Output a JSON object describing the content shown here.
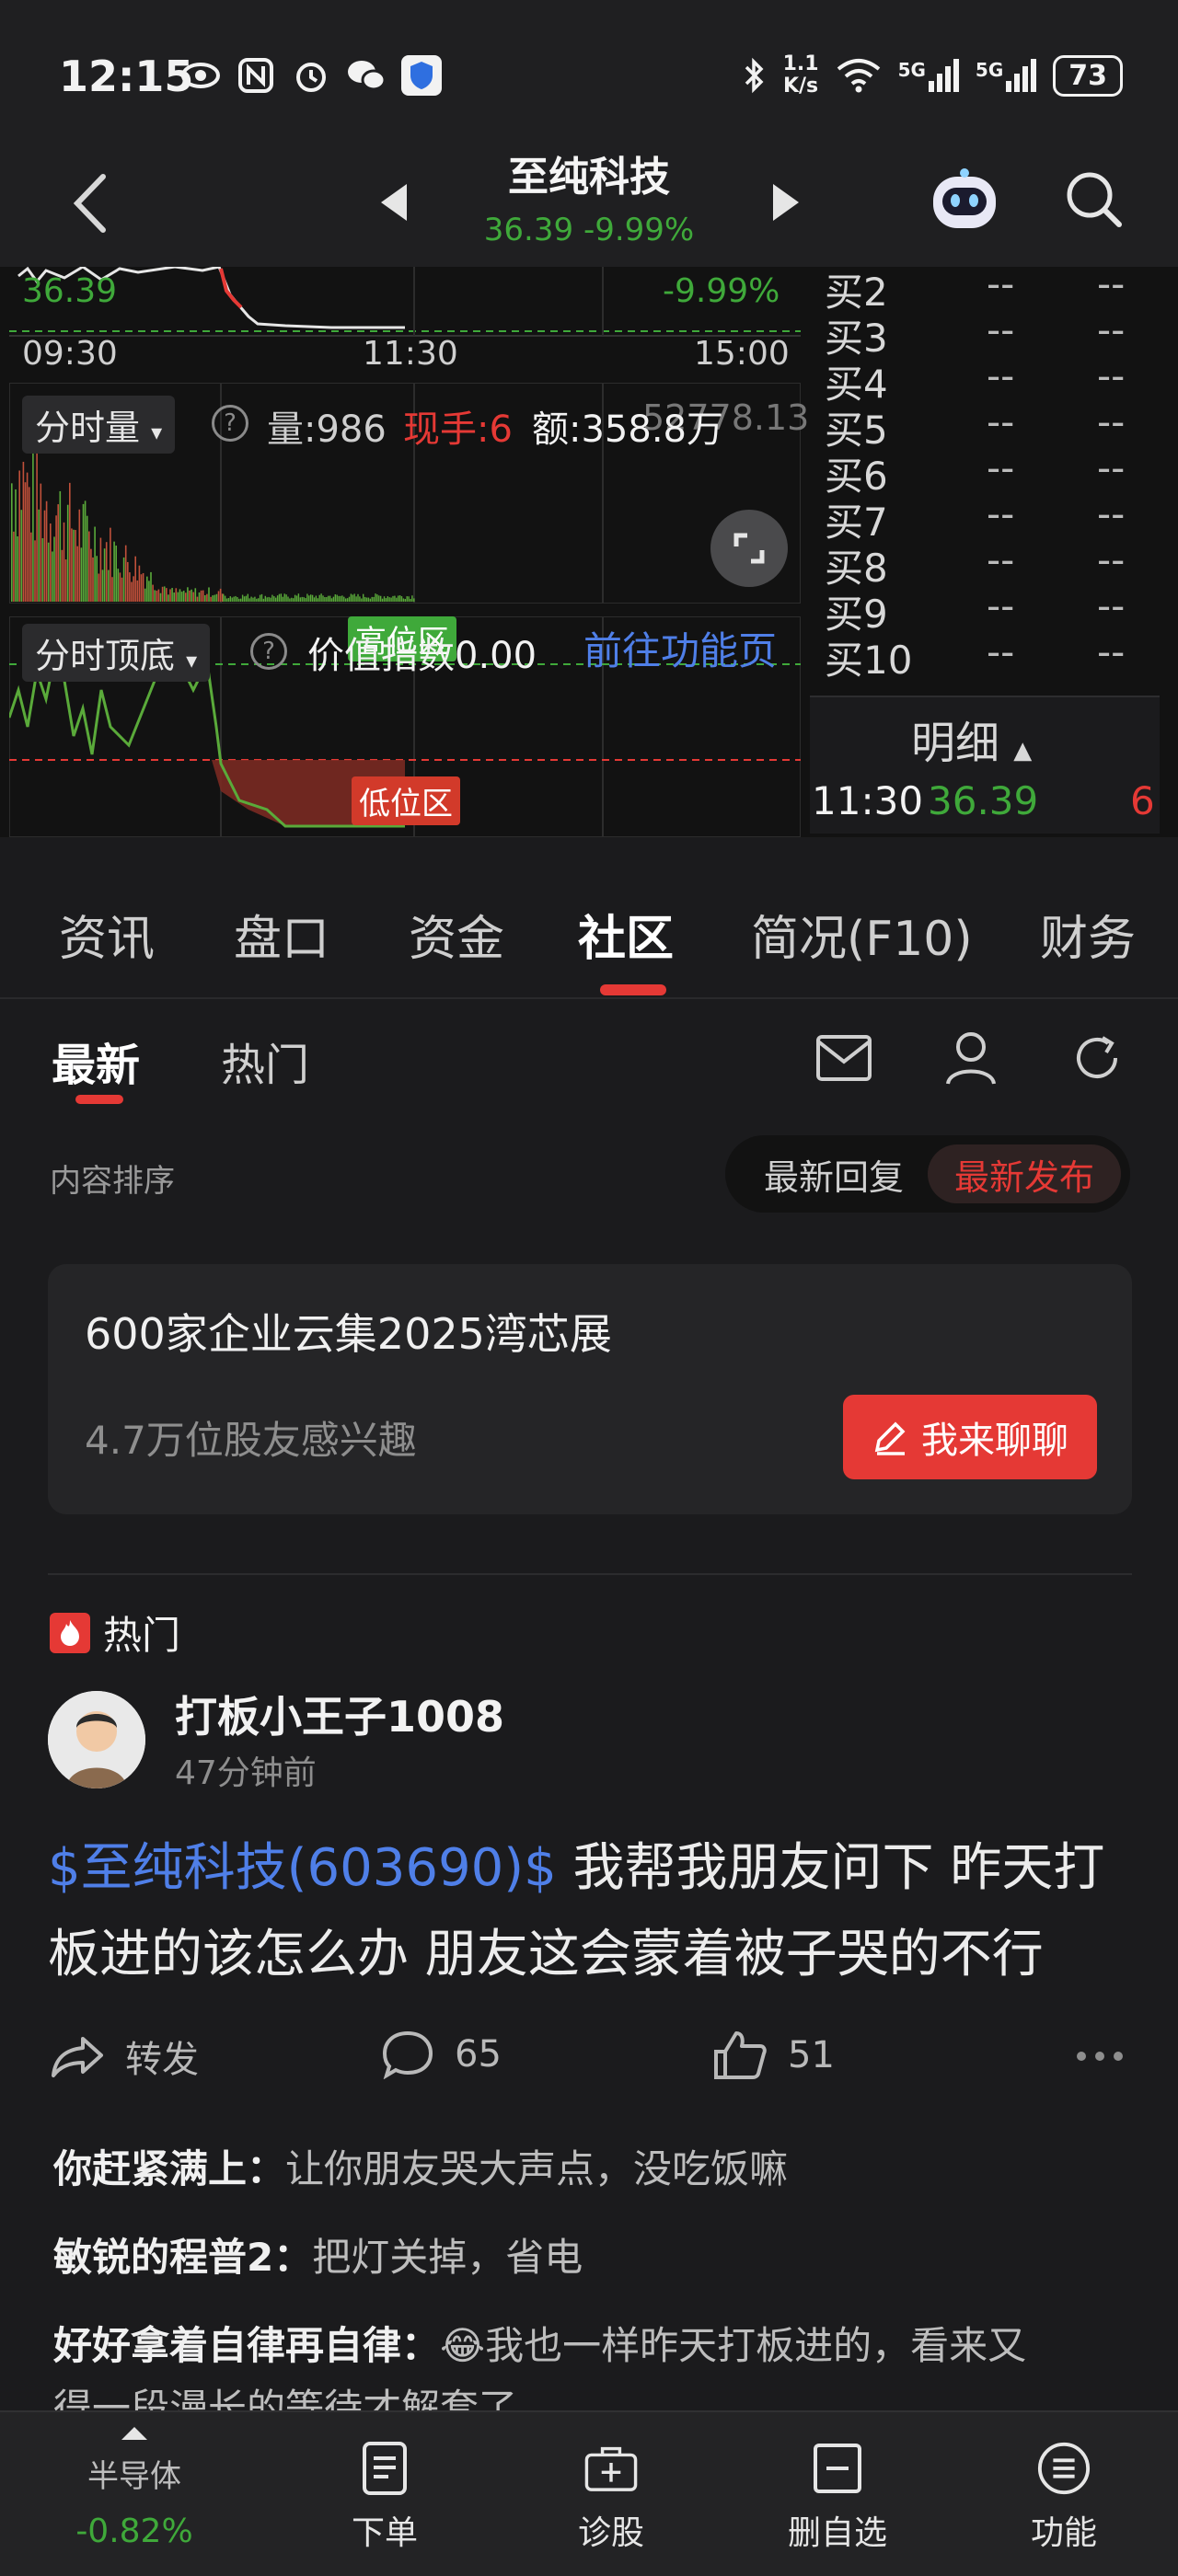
{
  "status_bar": {
    "time": "12:15",
    "net_speed_top": "1.1",
    "net_speed_bottom": "K/s",
    "signal1": "5G",
    "signal2": "5G",
    "battery": "73"
  },
  "header": {
    "stock_name": "至纯科技",
    "price": "36.39",
    "change": "-9.99%"
  },
  "chart": {
    "price_left": "36.39",
    "change_right": "-9.99%",
    "time_start": "09:30",
    "time_mid": "11:30",
    "time_end": "15:00",
    "volume_pill": "分时量",
    "volume_label": "量:986",
    "hand_label": "现手:6",
    "amount_label": "额:358.8万",
    "amount_overlap": "52778.13",
    "indicator_pill": "分时顶底",
    "indicator_value": "价值指数0.00",
    "high_tag": "高位区",
    "low_tag": "低位区",
    "goto_link": "前往功能页",
    "order_book": [
      {
        "label": "买2",
        "v1": "--",
        "v2": "--"
      },
      {
        "label": "买3",
        "v1": "--",
        "v2": "--"
      },
      {
        "label": "买4",
        "v1": "--",
        "v2": "--"
      },
      {
        "label": "买5",
        "v1": "--",
        "v2": "--"
      },
      {
        "label": "买6",
        "v1": "--",
        "v2": "--"
      },
      {
        "label": "买7",
        "v1": "--",
        "v2": "--"
      },
      {
        "label": "买8",
        "v1": "--",
        "v2": "--"
      },
      {
        "label": "买9",
        "v1": "--",
        "v2": "--"
      },
      {
        "label": "买10",
        "v1": "--",
        "v2": "--"
      }
    ],
    "detail_label": "明细",
    "detail_time": "11:30",
    "detail_price": "36.39",
    "detail_qty": "6"
  },
  "main_tabs": [
    "资讯",
    "盘口",
    "资金",
    "社区",
    "简况(F10)",
    "财务"
  ],
  "sub_tabs": [
    "最新",
    "热门"
  ],
  "sort": {
    "label": "内容排序",
    "option_reply": "最新回复",
    "option_publish": "最新发布"
  },
  "topic": {
    "title": "600家企业云集2025湾芯展",
    "interest": "4.7万位股友感兴趣",
    "button": "我来聊聊"
  },
  "post": {
    "hot_tag": "热门",
    "author": "打板小王子1008",
    "time": "47分钟前",
    "ticker": "$至纯科技(603690)$",
    "text": " 我帮我朋友问下 昨天打板进的该怎么办 朋友这会蒙着被子哭的不行",
    "forward": "转发",
    "comments": "65",
    "likes": "51"
  },
  "comments": [
    {
      "user": "你赶紧满上：",
      "text": "让你朋友哭大声点，没吃饭嘛"
    },
    {
      "user": "敏锐的程普2：",
      "text": "把灯关掉，省电"
    },
    {
      "user": "好好拿着自律再自律：",
      "text": "😂我也一样昨天打板进的，看来又"
    },
    {
      "user": "",
      "text": "得一段漫长的等待才解套了"
    }
  ],
  "bottom_nav": {
    "sector_name": "半导体",
    "sector_change": "-0.82%",
    "items": [
      "下单",
      "诊股",
      "删自选",
      "功能"
    ]
  },
  "colors": {
    "accent_red": "#e53935",
    "down_green": "#3fa93a",
    "link_blue": "#4f7fe8"
  }
}
